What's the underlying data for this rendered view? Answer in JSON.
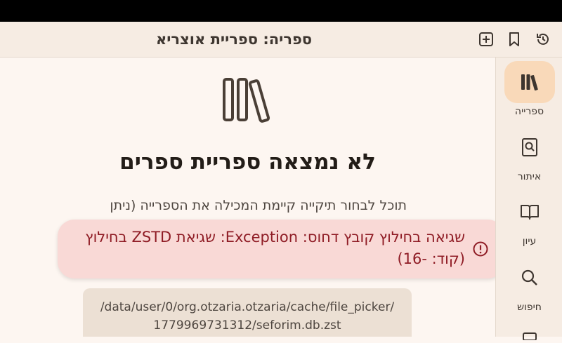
{
  "app_bar": {
    "title": "ספריה: ספריית אוצריא",
    "actions": [
      "add-icon",
      "bookmark-icon",
      "history-icon"
    ]
  },
  "sidebar": {
    "items": [
      {
        "label": "ספרייה",
        "icon": "library-icon",
        "active": true
      },
      {
        "label": "איתור",
        "icon": "find-book-icon",
        "active": false
      },
      {
        "label": "עיון",
        "icon": "open-book-icon",
        "active": false
      },
      {
        "label": "חיפוש",
        "icon": "search-icon",
        "active": false
      }
    ]
  },
  "main": {
    "heading": "לא נמצאה ספריית ספרים",
    "description": "תוכל לבחור תיקייה קיימת המכילה את הספרייה (ניתן",
    "path": "/data/user/0/org.otzaria.otzaria/cache/file_picker/1779969731312/seforim.db.zst"
  },
  "snackbar": {
    "message": "שגיאה בחילוץ קובץ דחוס: Exception: שגיאת ZSTD בחילוץ (קוד: -16)",
    "icon": "error-icon"
  },
  "colors": {
    "accent_pill": "#f9d9b9",
    "error_text": "#8f1c25",
    "error_bg": "#f9d9d6"
  }
}
